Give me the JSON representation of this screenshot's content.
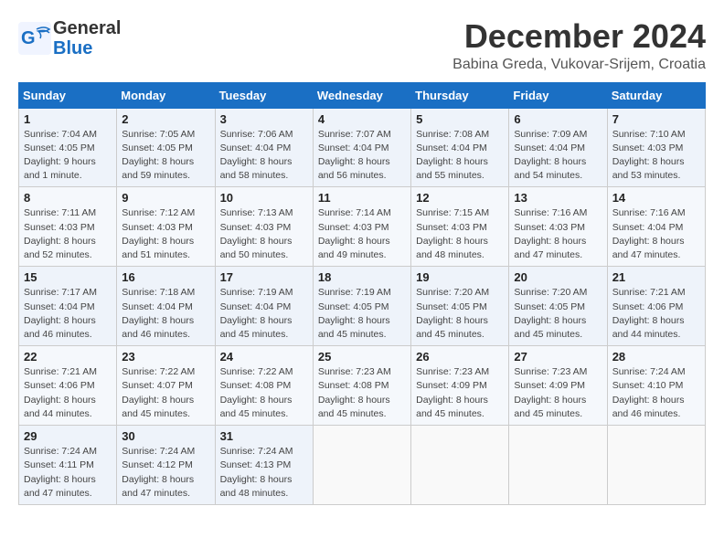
{
  "header": {
    "logo_general": "General",
    "logo_blue": "Blue",
    "month_title": "December 2024",
    "location": "Babina Greda, Vukovar-Srijem, Croatia"
  },
  "calendar": {
    "days_of_week": [
      "Sunday",
      "Monday",
      "Tuesday",
      "Wednesday",
      "Thursday",
      "Friday",
      "Saturday"
    ],
    "weeks": [
      [
        {
          "day": "1",
          "sunrise": "Sunrise: 7:04 AM",
          "sunset": "Sunset: 4:05 PM",
          "daylight": "Daylight: 9 hours and 1 minute."
        },
        {
          "day": "2",
          "sunrise": "Sunrise: 7:05 AM",
          "sunset": "Sunset: 4:05 PM",
          "daylight": "Daylight: 8 hours and 59 minutes."
        },
        {
          "day": "3",
          "sunrise": "Sunrise: 7:06 AM",
          "sunset": "Sunset: 4:04 PM",
          "daylight": "Daylight: 8 hours and 58 minutes."
        },
        {
          "day": "4",
          "sunrise": "Sunrise: 7:07 AM",
          "sunset": "Sunset: 4:04 PM",
          "daylight": "Daylight: 8 hours and 56 minutes."
        },
        {
          "day": "5",
          "sunrise": "Sunrise: 7:08 AM",
          "sunset": "Sunset: 4:04 PM",
          "daylight": "Daylight: 8 hours and 55 minutes."
        },
        {
          "day": "6",
          "sunrise": "Sunrise: 7:09 AM",
          "sunset": "Sunset: 4:04 PM",
          "daylight": "Daylight: 8 hours and 54 minutes."
        },
        {
          "day": "7",
          "sunrise": "Sunrise: 7:10 AM",
          "sunset": "Sunset: 4:03 PM",
          "daylight": "Daylight: 8 hours and 53 minutes."
        }
      ],
      [
        {
          "day": "8",
          "sunrise": "Sunrise: 7:11 AM",
          "sunset": "Sunset: 4:03 PM",
          "daylight": "Daylight: 8 hours and 52 minutes."
        },
        {
          "day": "9",
          "sunrise": "Sunrise: 7:12 AM",
          "sunset": "Sunset: 4:03 PM",
          "daylight": "Daylight: 8 hours and 51 minutes."
        },
        {
          "day": "10",
          "sunrise": "Sunrise: 7:13 AM",
          "sunset": "Sunset: 4:03 PM",
          "daylight": "Daylight: 8 hours and 50 minutes."
        },
        {
          "day": "11",
          "sunrise": "Sunrise: 7:14 AM",
          "sunset": "Sunset: 4:03 PM",
          "daylight": "Daylight: 8 hours and 49 minutes."
        },
        {
          "day": "12",
          "sunrise": "Sunrise: 7:15 AM",
          "sunset": "Sunset: 4:03 PM",
          "daylight": "Daylight: 8 hours and 48 minutes."
        },
        {
          "day": "13",
          "sunrise": "Sunrise: 7:16 AM",
          "sunset": "Sunset: 4:03 PM",
          "daylight": "Daylight: 8 hours and 47 minutes."
        },
        {
          "day": "14",
          "sunrise": "Sunrise: 7:16 AM",
          "sunset": "Sunset: 4:04 PM",
          "daylight": "Daylight: 8 hours and 47 minutes."
        }
      ],
      [
        {
          "day": "15",
          "sunrise": "Sunrise: 7:17 AM",
          "sunset": "Sunset: 4:04 PM",
          "daylight": "Daylight: 8 hours and 46 minutes."
        },
        {
          "day": "16",
          "sunrise": "Sunrise: 7:18 AM",
          "sunset": "Sunset: 4:04 PM",
          "daylight": "Daylight: 8 hours and 46 minutes."
        },
        {
          "day": "17",
          "sunrise": "Sunrise: 7:19 AM",
          "sunset": "Sunset: 4:04 PM",
          "daylight": "Daylight: 8 hours and 45 minutes."
        },
        {
          "day": "18",
          "sunrise": "Sunrise: 7:19 AM",
          "sunset": "Sunset: 4:05 PM",
          "daylight": "Daylight: 8 hours and 45 minutes."
        },
        {
          "day": "19",
          "sunrise": "Sunrise: 7:20 AM",
          "sunset": "Sunset: 4:05 PM",
          "daylight": "Daylight: 8 hours and 45 minutes."
        },
        {
          "day": "20",
          "sunrise": "Sunrise: 7:20 AM",
          "sunset": "Sunset: 4:05 PM",
          "daylight": "Daylight: 8 hours and 45 minutes."
        },
        {
          "day": "21",
          "sunrise": "Sunrise: 7:21 AM",
          "sunset": "Sunset: 4:06 PM",
          "daylight": "Daylight: 8 hours and 44 minutes."
        }
      ],
      [
        {
          "day": "22",
          "sunrise": "Sunrise: 7:21 AM",
          "sunset": "Sunset: 4:06 PM",
          "daylight": "Daylight: 8 hours and 44 minutes."
        },
        {
          "day": "23",
          "sunrise": "Sunrise: 7:22 AM",
          "sunset": "Sunset: 4:07 PM",
          "daylight": "Daylight: 8 hours and 45 minutes."
        },
        {
          "day": "24",
          "sunrise": "Sunrise: 7:22 AM",
          "sunset": "Sunset: 4:08 PM",
          "daylight": "Daylight: 8 hours and 45 minutes."
        },
        {
          "day": "25",
          "sunrise": "Sunrise: 7:23 AM",
          "sunset": "Sunset: 4:08 PM",
          "daylight": "Daylight: 8 hours and 45 minutes."
        },
        {
          "day": "26",
          "sunrise": "Sunrise: 7:23 AM",
          "sunset": "Sunset: 4:09 PM",
          "daylight": "Daylight: 8 hours and 45 minutes."
        },
        {
          "day": "27",
          "sunrise": "Sunrise: 7:23 AM",
          "sunset": "Sunset: 4:09 PM",
          "daylight": "Daylight: 8 hours and 45 minutes."
        },
        {
          "day": "28",
          "sunrise": "Sunrise: 7:24 AM",
          "sunset": "Sunset: 4:10 PM",
          "daylight": "Daylight: 8 hours and 46 minutes."
        }
      ],
      [
        {
          "day": "29",
          "sunrise": "Sunrise: 7:24 AM",
          "sunset": "Sunset: 4:11 PM",
          "daylight": "Daylight: 8 hours and 47 minutes."
        },
        {
          "day": "30",
          "sunrise": "Sunrise: 7:24 AM",
          "sunset": "Sunset: 4:12 PM",
          "daylight": "Daylight: 8 hours and 47 minutes."
        },
        {
          "day": "31",
          "sunrise": "Sunrise: 7:24 AM",
          "sunset": "Sunset: 4:13 PM",
          "daylight": "Daylight: 8 hours and 48 minutes."
        },
        null,
        null,
        null,
        null
      ]
    ]
  }
}
